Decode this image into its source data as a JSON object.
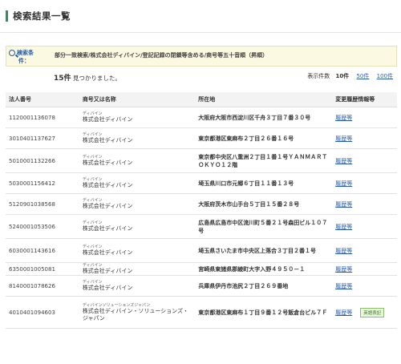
{
  "page_title": "検索結果一覧",
  "condition": {
    "label_top": "検索条",
    "label_bottom": "件：",
    "text": "部分一致検索/株式会社ディバイン/登記記録の閉鎖等含める/商号等五十音順（昇順）"
  },
  "result": {
    "count": "15件",
    "suffix": "見つかりました。"
  },
  "per_page": {
    "label": "表示件数",
    "current": "10件",
    "option_50": "50件",
    "option_100": "100件"
  },
  "table": {
    "headers": [
      "法人番号",
      "商号又は名称",
      "所在地",
      "変更履歴情報等"
    ],
    "rows": [
      {
        "number": "1120001136078",
        "kana": "ディバイン",
        "name": "株式会社ディバイン",
        "address": "大阪府大阪市西淀川区千舟３丁目７番３０号",
        "history": "履歴等",
        "badge": ""
      },
      {
        "number": "3010401137627",
        "kana": "ディバイン",
        "name": "株式会社ディバイン",
        "address": "東京都港区東麻布２丁目２６番１６号",
        "history": "履歴等",
        "badge": ""
      },
      {
        "number": "5010001132266",
        "kana": "ディバイン",
        "name": "株式会社ディバイン",
        "address": "東京都中央区八重洲２丁目１番１号ＹＡＮＭＡＲＴＯＫＹＯ１２階",
        "history": "履歴等",
        "badge": ""
      },
      {
        "number": "5030001156412",
        "kana": "ディバイン",
        "name": "株式会社ディバイン",
        "address": "埼玉県川口市元郷６丁目１１番１３号",
        "history": "履歴等",
        "badge": ""
      },
      {
        "number": "5120901038568",
        "kana": "ディバイン",
        "name": "株式会社ディバイン",
        "address": "大阪府茨木市山手台５丁目１５番２８号",
        "history": "履歴等",
        "badge": ""
      },
      {
        "number": "5240001053506",
        "kana": "ディバイン",
        "name": "株式会社ディバイン",
        "address": "広島県広島市中区流川町５番２１号森田ビル１０７号",
        "history": "履歴等",
        "badge": ""
      },
      {
        "number": "6030001143616",
        "kana": "ディバイン",
        "name": "株式会社ディバイン",
        "address": "埼玉県さいたま市中央区上落合３丁目２番１号",
        "history": "履歴等",
        "badge": ""
      },
      {
        "number": "6350001005081",
        "kana": "ディバイン",
        "name": "株式会社ディバイン",
        "address": "宮崎県東諸県郡綾町大字入野４９５０－１",
        "history": "履歴等",
        "badge": ""
      },
      {
        "number": "8140001078626",
        "kana": "ディバイン",
        "name": "株式会社ディバイン",
        "address": "兵庫県伊丹市池尻２丁目２６９番地",
        "history": "履歴等",
        "badge": ""
      },
      {
        "number": "4010401094603",
        "kana": "ディバインソリューションズジャパン",
        "name": "株式会社ディバイン・ソリューションズ・ジャパン",
        "address": "東京都港区東麻布１丁目９番１２号飯倉台ビル７Ｆ",
        "history": "履歴等",
        "badge": "英語表記"
      }
    ]
  },
  "colors": {
    "accent": "#2f8f5b",
    "link": "#2a5db0",
    "condition_bg": "#fbf9e2"
  }
}
